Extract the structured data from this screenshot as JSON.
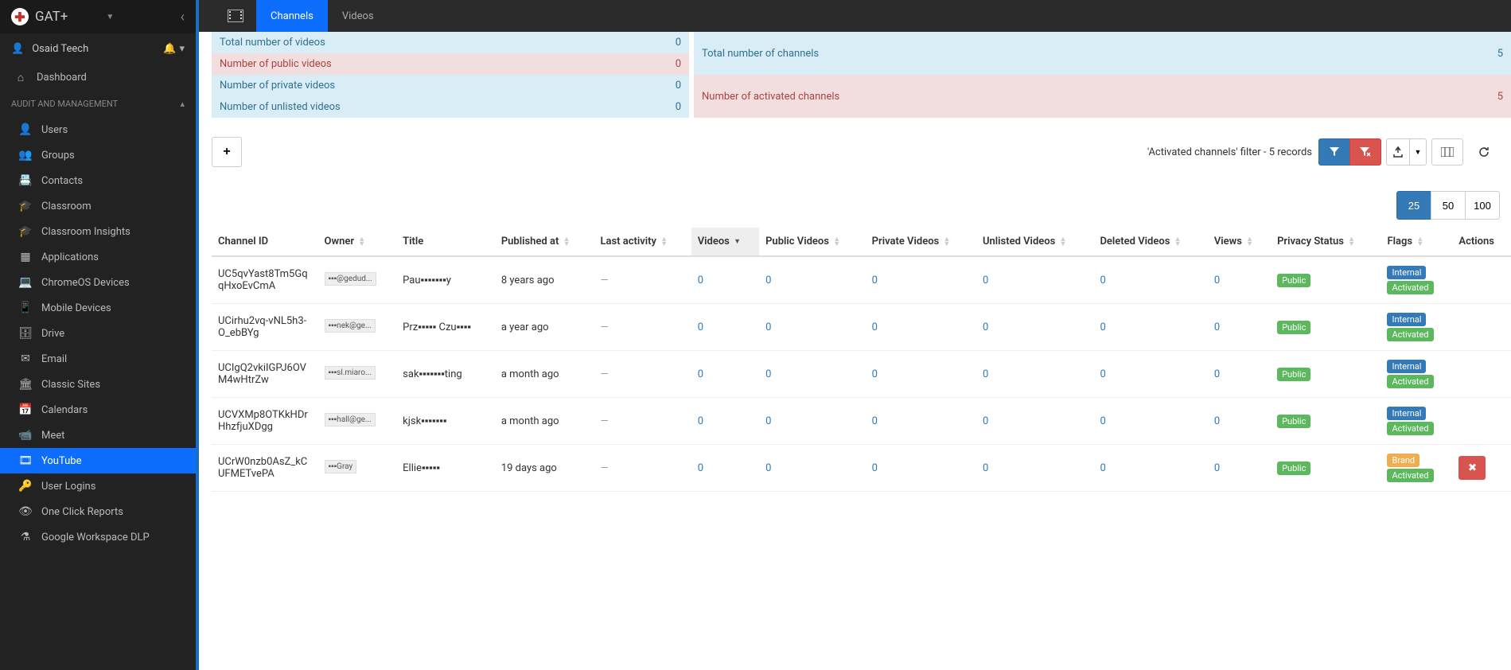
{
  "brand": "GAT+",
  "user": {
    "name": "Osaid Teech"
  },
  "sidebar": {
    "dashboard": "Dashboard",
    "section": "AUDIT AND MANAGEMENT",
    "items": [
      {
        "label": "Users",
        "icon": "👤"
      },
      {
        "label": "Groups",
        "icon": "👥"
      },
      {
        "label": "Contacts",
        "icon": "📇"
      },
      {
        "label": "Classroom",
        "icon": "🎓"
      },
      {
        "label": "Classroom Insights",
        "icon": "🎓"
      },
      {
        "label": "Applications",
        "icon": "▦"
      },
      {
        "label": "ChromeOS Devices",
        "icon": "💻"
      },
      {
        "label": "Mobile Devices",
        "icon": "📱"
      },
      {
        "label": "Drive",
        "icon": "🗄"
      },
      {
        "label": "Email",
        "icon": "✉"
      },
      {
        "label": "Classic Sites",
        "icon": "🏛"
      },
      {
        "label": "Calendars",
        "icon": "📅"
      },
      {
        "label": "Meet",
        "icon": "📹"
      },
      {
        "label": "YouTube",
        "icon": "🎞"
      },
      {
        "label": "User Logins",
        "icon": "🔑"
      },
      {
        "label": "One Click Reports",
        "icon": "👁"
      },
      {
        "label": "Google Workspace DLP",
        "icon": "⚗"
      }
    ]
  },
  "tabs": {
    "channels": "Channels",
    "videos": "Videos"
  },
  "stats_left": [
    {
      "label": "Total number of videos",
      "value": "0",
      "cls": "blue"
    },
    {
      "label": "Number of public videos",
      "value": "0",
      "cls": "pink"
    },
    {
      "label": "Number of private videos",
      "value": "0",
      "cls": "blue"
    },
    {
      "label": "Number of unlisted videos",
      "value": "0",
      "cls": "blue"
    }
  ],
  "stats_right": [
    {
      "label": "Total number of channels",
      "value": "5",
      "cls": "blue"
    },
    {
      "label": "Number of activated channels",
      "value": "5",
      "cls": "pink"
    }
  ],
  "toolbar": {
    "filter_text": "'Activated channels' filter -  5 records"
  },
  "pager": {
    "opts": [
      "25",
      "50",
      "100"
    ],
    "active": "25"
  },
  "columns": [
    "Channel ID",
    "Owner",
    "Title",
    "Published at",
    "Last activity",
    "Videos",
    "Public Videos",
    "Private Videos",
    "Unlisted Videos",
    "Deleted Videos",
    "Views",
    "Privacy Status",
    "Flags",
    "Actions"
  ],
  "rows": [
    {
      "id": "UC5qvYast8Tm5GqqHxoEvCmA",
      "owner": "▪▪▪@gedud...",
      "title": "Pau▪▪▪▪▪▪▪y",
      "published": "8 years ago",
      "last": "—",
      "videos": "0",
      "pub": "0",
      "priv": "0",
      "unl": "0",
      "del": "0",
      "views": "0",
      "privacy": "Public",
      "flags": [
        "Internal",
        "Activated"
      ],
      "flag_cls": [
        "blue",
        "green"
      ],
      "actions": ""
    },
    {
      "id": "UCirhu2vq-vNL5h3-O_ebBYg",
      "owner": "▪▪▪nek@ge...",
      "title": "Prz▪▪▪▪▪ Czu▪▪▪▪",
      "published": "a year ago",
      "last": "—",
      "videos": "0",
      "pub": "0",
      "priv": "0",
      "unl": "0",
      "del": "0",
      "views": "0",
      "privacy": "Public",
      "flags": [
        "Internal",
        "Activated"
      ],
      "flag_cls": [
        "blue",
        "green"
      ],
      "actions": ""
    },
    {
      "id": "UCIgQ2vkiIGPJ6OVM4wHtrZw",
      "owner": "▪▪▪sl.miaro...",
      "title": "sak▪▪▪▪▪▪▪ting",
      "published": "a month ago",
      "last": "—",
      "videos": "0",
      "pub": "0",
      "priv": "0",
      "unl": "0",
      "del": "0",
      "views": "0",
      "privacy": "Public",
      "flags": [
        "Internal",
        "Activated"
      ],
      "flag_cls": [
        "blue",
        "green"
      ],
      "actions": ""
    },
    {
      "id": "UCVXMp8OTKkHDrHhzfjuXDgg",
      "owner": "▪▪▪hall@ge...",
      "title": "kjsk▪▪▪▪▪▪▪",
      "published": "a month ago",
      "last": "—",
      "videos": "0",
      "pub": "0",
      "priv": "0",
      "unl": "0",
      "del": "0",
      "views": "0",
      "privacy": "Public",
      "flags": [
        "Internal",
        "Activated"
      ],
      "flag_cls": [
        "blue",
        "green"
      ],
      "actions": ""
    },
    {
      "id": "UCrW0nzb0AsZ_kCUFMETvePA",
      "owner": "▪▪▪Gray",
      "title": "Ellie▪▪▪▪▪",
      "published": "19 days ago",
      "last": "—",
      "videos": "0",
      "pub": "0",
      "priv": "0",
      "unl": "0",
      "del": "0",
      "views": "0",
      "privacy": "Public",
      "flags": [
        "Brand",
        "Activated"
      ],
      "flag_cls": [
        "orange",
        "green"
      ],
      "actions": "del"
    }
  ]
}
